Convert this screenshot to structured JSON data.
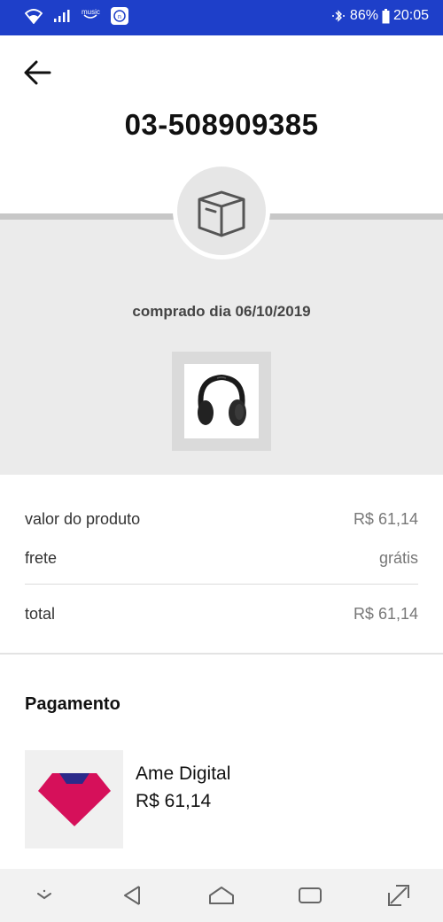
{
  "status_bar": {
    "music_label": "music",
    "battery": "86%",
    "time": "20:05",
    "background": "#1e3fc9"
  },
  "header": {
    "order_number": "03-508909385"
  },
  "purchase": {
    "date_text": "comprado dia 06/10/2019",
    "product_icon": "headphones-image"
  },
  "summary": {
    "rows": [
      {
        "label": "valor do produto",
        "value": "R$ 61,14"
      },
      {
        "label": "frete",
        "value": "grátis"
      }
    ],
    "total_label": "total",
    "total_value": "R$ 61,14"
  },
  "payment": {
    "title": "Pagamento",
    "method_name": "Ame Digital",
    "method_amount": "R$ 61,14",
    "logo_colors": {
      "top": "#2b2a8a",
      "main": "#d6105a"
    }
  },
  "nav": {
    "icons": [
      "keyboard-hide-icon",
      "back-triangle-icon",
      "home-icon",
      "recents-icon",
      "expand-icon"
    ]
  }
}
